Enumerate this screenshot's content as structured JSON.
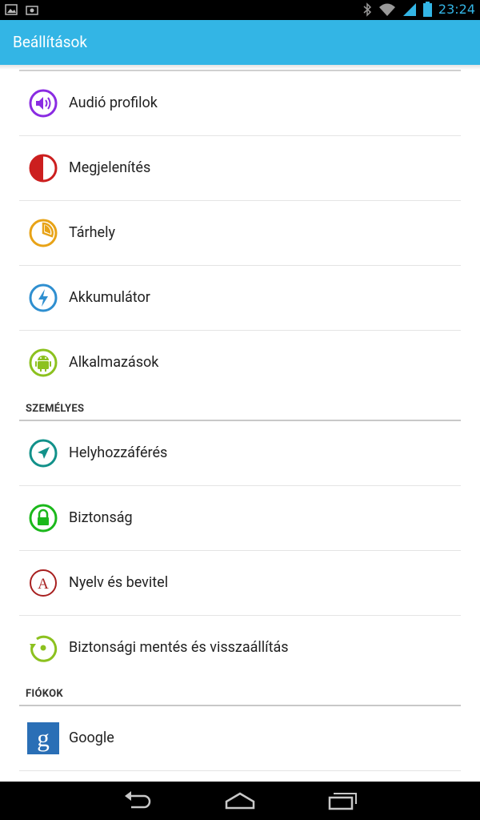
{
  "status_bar": {
    "time": "23:24",
    "icons": [
      "gallery-icon",
      "screenshot-icon",
      "bluetooth-icon",
      "wifi-icon",
      "signal-icon",
      "battery-icon"
    ]
  },
  "action_bar": {
    "title": "Beállítások",
    "color": "#33b5e5"
  },
  "device_items": [
    {
      "label": "Audió profilok",
      "icon": "audio-profiles-icon",
      "color": "#8a2be2"
    },
    {
      "label": "Megjelenítés",
      "icon": "display-icon",
      "color": "#cc1f1f"
    },
    {
      "label": "Tárhely",
      "icon": "storage-icon",
      "color": "#e8a317"
    },
    {
      "label": "Akkumulátor",
      "icon": "battery-icon",
      "color": "#2f8fd0"
    },
    {
      "label": "Alkalmazások",
      "icon": "apps-android-icon",
      "color": "#8cc11f"
    }
  ],
  "personal": {
    "header": "SZEMÉLYES",
    "items": [
      {
        "label": "Helyhozzáférés",
        "icon": "location-icon",
        "color": "#12918a"
      },
      {
        "label": "Biztonság",
        "icon": "lock-icon",
        "color": "#1bb81b"
      },
      {
        "label": "Nyelv és bevitel",
        "icon": "language-icon",
        "color": "#a82020"
      },
      {
        "label": "Biztonsági mentés és visszaállítás",
        "icon": "backup-icon",
        "color": "#8cc11f"
      }
    ]
  },
  "accounts": {
    "header": "FIÓKOK",
    "items": [
      {
        "label": "Google",
        "icon": "google-icon",
        "color": "#2a6fb6"
      }
    ]
  },
  "nav_bar": {
    "buttons": [
      "back-icon",
      "home-icon",
      "recent-apps-icon"
    ]
  }
}
